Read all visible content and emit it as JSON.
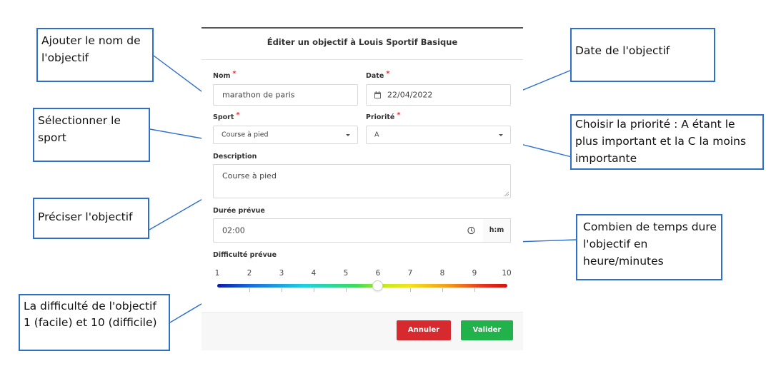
{
  "modal": {
    "title": "Éditer un objectif à Louis Sportif Basique",
    "fields": {
      "name": {
        "label": "Nom",
        "required": "*",
        "value": "marathon de paris"
      },
      "date": {
        "label": "Date",
        "required": "*",
        "value": "22/04/2022",
        "icon": "calendar-icon"
      },
      "sport": {
        "label": "Sport",
        "required": "*",
        "value": "Course à pied"
      },
      "priority": {
        "label": "Priorité",
        "required": "*",
        "value": "A"
      },
      "description": {
        "label": "Description",
        "value": "Course à pied"
      },
      "duration": {
        "label": "Durée prévue",
        "value": "02:00",
        "unit": "h:m",
        "icon": "clock-icon"
      },
      "difficulty": {
        "label": "Difficulté prévue",
        "ticks": [
          "1",
          "2",
          "3",
          "4",
          "5",
          "6",
          "7",
          "8",
          "9",
          "10"
        ],
        "value": 6,
        "min": 1,
        "max": 10
      }
    },
    "buttons": {
      "cancel": "Annuler",
      "submit": "Valider"
    },
    "colors": {
      "cancel": "#d62a2f",
      "submit": "#22b24c",
      "required": "#d9363e",
      "callout_border": "#2d6fc9"
    }
  },
  "callouts": {
    "name": "Ajouter le nom de l'objectif",
    "sport": "Sélectionner le sport",
    "description": "Préciser l'objectif",
    "difficulty": "La difficulté de l'objectif 1 (facile) et 10 (difficile)",
    "date": "Date de l'objectif",
    "priority": "Choisir la priorité : A étant  le plus important et la  C la moins importante",
    "duration": "Combien de temps dure l'objectif en heure/minutes"
  }
}
